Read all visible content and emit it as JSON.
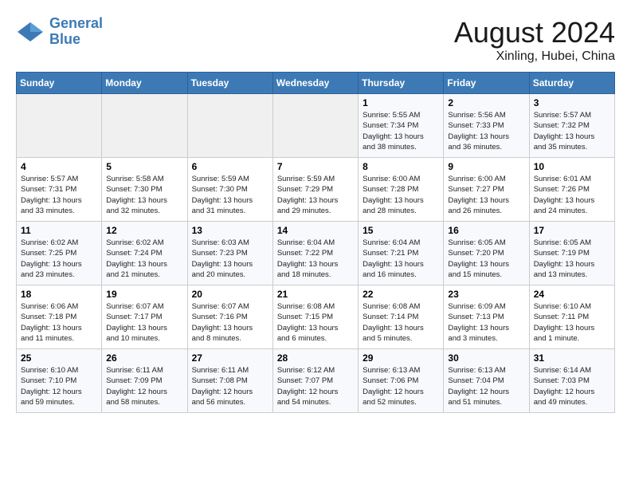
{
  "header": {
    "logo_line1": "General",
    "logo_line2": "Blue",
    "month_year": "August 2024",
    "location": "Xinling, Hubei, China"
  },
  "days_of_week": [
    "Sunday",
    "Monday",
    "Tuesday",
    "Wednesday",
    "Thursday",
    "Friday",
    "Saturday"
  ],
  "weeks": [
    [
      {
        "num": "",
        "info": ""
      },
      {
        "num": "",
        "info": ""
      },
      {
        "num": "",
        "info": ""
      },
      {
        "num": "",
        "info": ""
      },
      {
        "num": "1",
        "info": "Sunrise: 5:55 AM\nSunset: 7:34 PM\nDaylight: 13 hours\nand 38 minutes."
      },
      {
        "num": "2",
        "info": "Sunrise: 5:56 AM\nSunset: 7:33 PM\nDaylight: 13 hours\nand 36 minutes."
      },
      {
        "num": "3",
        "info": "Sunrise: 5:57 AM\nSunset: 7:32 PM\nDaylight: 13 hours\nand 35 minutes."
      }
    ],
    [
      {
        "num": "4",
        "info": "Sunrise: 5:57 AM\nSunset: 7:31 PM\nDaylight: 13 hours\nand 33 minutes."
      },
      {
        "num": "5",
        "info": "Sunrise: 5:58 AM\nSunset: 7:30 PM\nDaylight: 13 hours\nand 32 minutes."
      },
      {
        "num": "6",
        "info": "Sunrise: 5:59 AM\nSunset: 7:30 PM\nDaylight: 13 hours\nand 31 minutes."
      },
      {
        "num": "7",
        "info": "Sunrise: 5:59 AM\nSunset: 7:29 PM\nDaylight: 13 hours\nand 29 minutes."
      },
      {
        "num": "8",
        "info": "Sunrise: 6:00 AM\nSunset: 7:28 PM\nDaylight: 13 hours\nand 28 minutes."
      },
      {
        "num": "9",
        "info": "Sunrise: 6:00 AM\nSunset: 7:27 PM\nDaylight: 13 hours\nand 26 minutes."
      },
      {
        "num": "10",
        "info": "Sunrise: 6:01 AM\nSunset: 7:26 PM\nDaylight: 13 hours\nand 24 minutes."
      }
    ],
    [
      {
        "num": "11",
        "info": "Sunrise: 6:02 AM\nSunset: 7:25 PM\nDaylight: 13 hours\nand 23 minutes."
      },
      {
        "num": "12",
        "info": "Sunrise: 6:02 AM\nSunset: 7:24 PM\nDaylight: 13 hours\nand 21 minutes."
      },
      {
        "num": "13",
        "info": "Sunrise: 6:03 AM\nSunset: 7:23 PM\nDaylight: 13 hours\nand 20 minutes."
      },
      {
        "num": "14",
        "info": "Sunrise: 6:04 AM\nSunset: 7:22 PM\nDaylight: 13 hours\nand 18 minutes."
      },
      {
        "num": "15",
        "info": "Sunrise: 6:04 AM\nSunset: 7:21 PM\nDaylight: 13 hours\nand 16 minutes."
      },
      {
        "num": "16",
        "info": "Sunrise: 6:05 AM\nSunset: 7:20 PM\nDaylight: 13 hours\nand 15 minutes."
      },
      {
        "num": "17",
        "info": "Sunrise: 6:05 AM\nSunset: 7:19 PM\nDaylight: 13 hours\nand 13 minutes."
      }
    ],
    [
      {
        "num": "18",
        "info": "Sunrise: 6:06 AM\nSunset: 7:18 PM\nDaylight: 13 hours\nand 11 minutes."
      },
      {
        "num": "19",
        "info": "Sunrise: 6:07 AM\nSunset: 7:17 PM\nDaylight: 13 hours\nand 10 minutes."
      },
      {
        "num": "20",
        "info": "Sunrise: 6:07 AM\nSunset: 7:16 PM\nDaylight: 13 hours\nand 8 minutes."
      },
      {
        "num": "21",
        "info": "Sunrise: 6:08 AM\nSunset: 7:15 PM\nDaylight: 13 hours\nand 6 minutes."
      },
      {
        "num": "22",
        "info": "Sunrise: 6:08 AM\nSunset: 7:14 PM\nDaylight: 13 hours\nand 5 minutes."
      },
      {
        "num": "23",
        "info": "Sunrise: 6:09 AM\nSunset: 7:13 PM\nDaylight: 13 hours\nand 3 minutes."
      },
      {
        "num": "24",
        "info": "Sunrise: 6:10 AM\nSunset: 7:11 PM\nDaylight: 13 hours\nand 1 minute."
      }
    ],
    [
      {
        "num": "25",
        "info": "Sunrise: 6:10 AM\nSunset: 7:10 PM\nDaylight: 12 hours\nand 59 minutes."
      },
      {
        "num": "26",
        "info": "Sunrise: 6:11 AM\nSunset: 7:09 PM\nDaylight: 12 hours\nand 58 minutes."
      },
      {
        "num": "27",
        "info": "Sunrise: 6:11 AM\nSunset: 7:08 PM\nDaylight: 12 hours\nand 56 minutes."
      },
      {
        "num": "28",
        "info": "Sunrise: 6:12 AM\nSunset: 7:07 PM\nDaylight: 12 hours\nand 54 minutes."
      },
      {
        "num": "29",
        "info": "Sunrise: 6:13 AM\nSunset: 7:06 PM\nDaylight: 12 hours\nand 52 minutes."
      },
      {
        "num": "30",
        "info": "Sunrise: 6:13 AM\nSunset: 7:04 PM\nDaylight: 12 hours\nand 51 minutes."
      },
      {
        "num": "31",
        "info": "Sunrise: 6:14 AM\nSunset: 7:03 PM\nDaylight: 12 hours\nand 49 minutes."
      }
    ]
  ]
}
